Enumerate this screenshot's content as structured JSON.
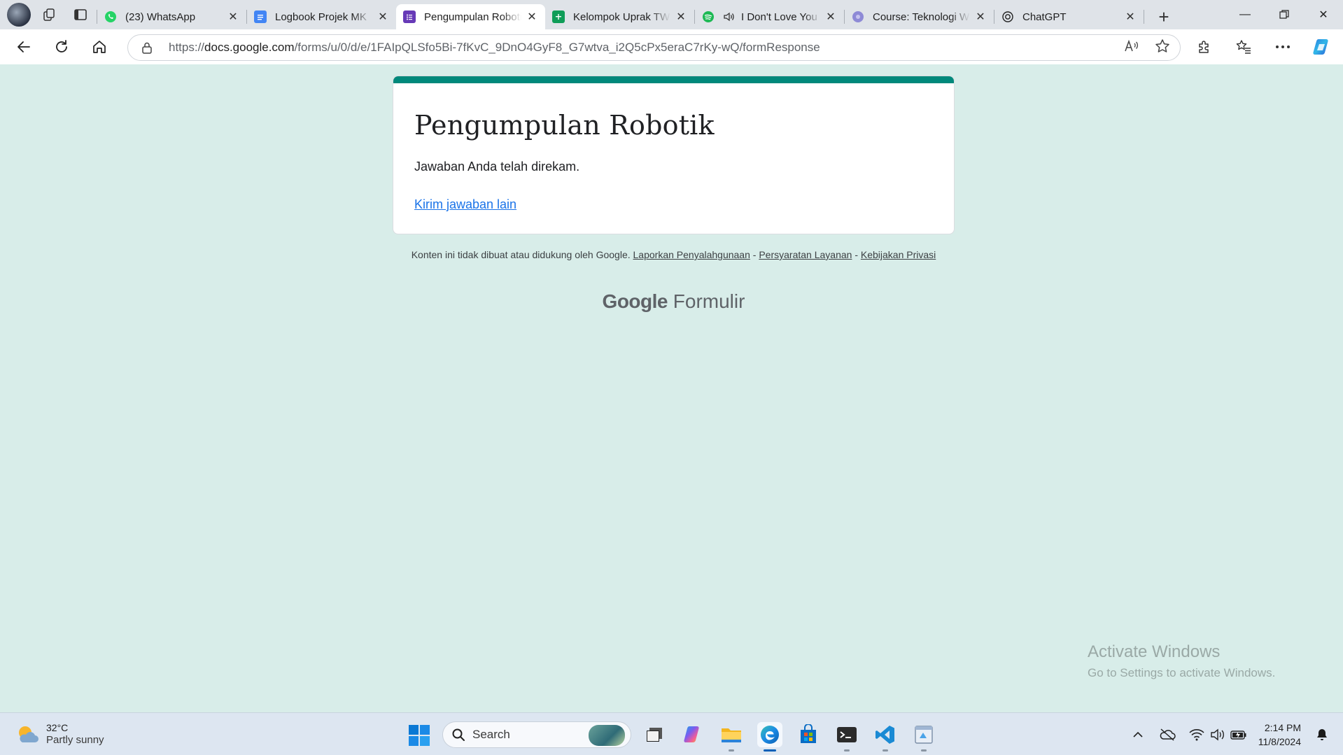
{
  "browser": {
    "tabs": [
      {
        "label": "(23) WhatsApp",
        "icon": "whatsapp-icon",
        "color": "#25d366",
        "active": false
      },
      {
        "label": "Logbook Projek MK",
        "icon": "google-docs-icon",
        "color": "#4285f4",
        "active": false
      },
      {
        "label": "Pengumpulan Robotik",
        "icon": "google-forms-icon",
        "color": "#673ab7",
        "active": true
      },
      {
        "label": "Kelompok Uprak TW",
        "icon": "google-sheets-icon",
        "color": "#0f9d58",
        "active": false
      },
      {
        "label": "I Don't Love You",
        "icon": "spotify-icon",
        "color": "#1db954",
        "active": false
      },
      {
        "label": "Course: Teknologi W",
        "icon": "moodle-icon",
        "color": "#8e8ad6",
        "active": false
      },
      {
        "label": "ChatGPT",
        "icon": "chatgpt-icon",
        "color": "#222222",
        "active": false
      }
    ],
    "address": {
      "prefix": "https://",
      "domain": "docs.google.com",
      "path": "/forms/u/0/d/e/1FAIpQLSfo5Bi-7fKvC_9DnO4GyF8_G7wtva_i2Q5cPx5eraC7rKy-wQ/formResponse"
    }
  },
  "form": {
    "title": "Pengumpulan Robotik",
    "message": "Jawaban Anda telah direkam.",
    "link": "Kirim jawaban lain",
    "accent": "#00897b"
  },
  "footer": {
    "note": "Konten ini tidak dibuat atau didukung oleh Google.",
    "report": "Laporkan Penyalahgunaan",
    "terms": "Persyaratan Layanan",
    "privacy": "Kebijakan Privasi",
    "sep": "-",
    "logo_google": "Google",
    "logo_product": "Formulir"
  },
  "watermark": {
    "line1": "Activate Windows",
    "line2": "Go to Settings to activate Windows."
  },
  "taskbar": {
    "temperature": "32°C",
    "condition": "Partly sunny",
    "search_label": "Search",
    "time": "2:14 PM",
    "date": "11/8/2024"
  }
}
